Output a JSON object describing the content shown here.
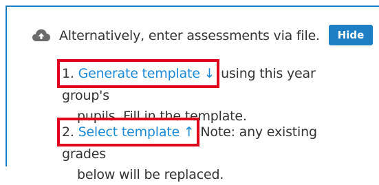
{
  "header": {
    "icon": "cloud-upload-icon",
    "text": "Alternatively, enter assessments via file.",
    "hide_label": "Hide",
    "accent": "#1f7fc4"
  },
  "steps": [
    {
      "number": "1.",
      "link_label": "Generate template ↓",
      "rest_line1": "using this year group's",
      "rest_line2": "pupils. Fill in the template."
    },
    {
      "number": "2.",
      "link_label": "Select template ↑",
      "rest_line1": "Note: any existing grades",
      "rest_line2": "below will be replaced."
    }
  ],
  "colors": {
    "link": "#1a8ad8",
    "highlight": "#e0001b",
    "text": "#333333"
  }
}
